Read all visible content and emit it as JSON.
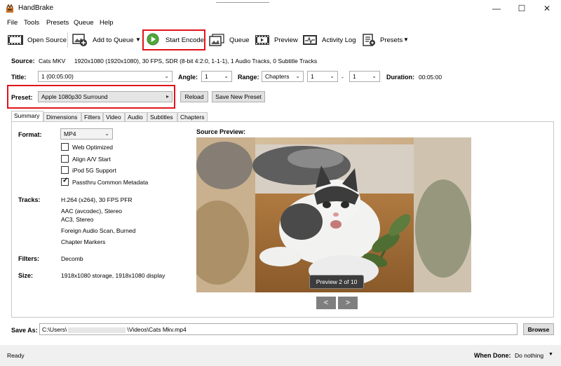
{
  "window": {
    "title": "HandBrake",
    "controls": [
      "minimize-icon",
      "maximize-icon",
      "close-icon"
    ]
  },
  "menu": [
    "File",
    "Tools",
    "Presets",
    "Queue",
    "Help"
  ],
  "toolbar": {
    "open_source": "Open Source",
    "add_to_queue": "Add to Queue",
    "start_encode": "Start Encode",
    "queue": "Queue",
    "preview": "Preview",
    "activity_log": "Activity Log",
    "presets": "Presets"
  },
  "source": {
    "label": "Source:",
    "name": "Cats MKV",
    "details": "1920x1080 (1920x1080), 30 FPS, SDR (8-bit 4:2:0, 1-1-1), 1 Audio Tracks, 0 Subtitle Tracks"
  },
  "title_row": {
    "title_label": "Title:",
    "title_value": "1 (00:05:00)",
    "angle_label": "Angle:",
    "angle_value": "1",
    "range_label": "Range:",
    "range_value": "Chapters",
    "range_start": "1",
    "range_sep": "-",
    "range_end": "1",
    "duration_label": "Duration:",
    "duration_value": "00:05:00"
  },
  "preset_row": {
    "label": "Preset:",
    "value": "Apple 1080p30 Surround",
    "reload": "Reload",
    "save_new": "Save New Preset"
  },
  "tabs": [
    "Summary",
    "Dimensions",
    "Filters",
    "Video",
    "Audio",
    "Subtitles",
    "Chapters"
  ],
  "active_tab": "Summary",
  "summary": {
    "format_label": "Format:",
    "format_value": "MP4",
    "options": [
      {
        "label": "Web Optimized",
        "checked": false
      },
      {
        "label": "Align A/V Start",
        "checked": false
      },
      {
        "label": "iPod 5G Support",
        "checked": false
      },
      {
        "label": "Passthru Common Metadata",
        "checked": true
      }
    ],
    "tracks_label": "Tracks:",
    "tracks": [
      "H.264 (x264), 30 FPS PFR",
      "AAC (avcodec), Stereo",
      "AC3, Stereo",
      "Foreign Audio Scan, Burned",
      "Chapter Markers"
    ],
    "filters_label": "Filters:",
    "filters_value": "Decomb",
    "size_label": "Size:",
    "size_value": "1918x1080 storage, 1918x1080 display"
  },
  "source_preview": {
    "label": "Source Preview:",
    "caption": "Preview 2 of 10",
    "prev": "<",
    "next": ">"
  },
  "save_as": {
    "label": "Save As:",
    "path_start": "C:\\Users\\",
    "path_end": "\\Videos\\Cats Mkv.mp4",
    "browse": "Browse"
  },
  "status": {
    "text": "Ready",
    "when_done_label": "When Done:",
    "when_done_value": "Do nothing"
  },
  "colors": {
    "highlight": "#e1141b",
    "start_green": "#52a63a"
  }
}
